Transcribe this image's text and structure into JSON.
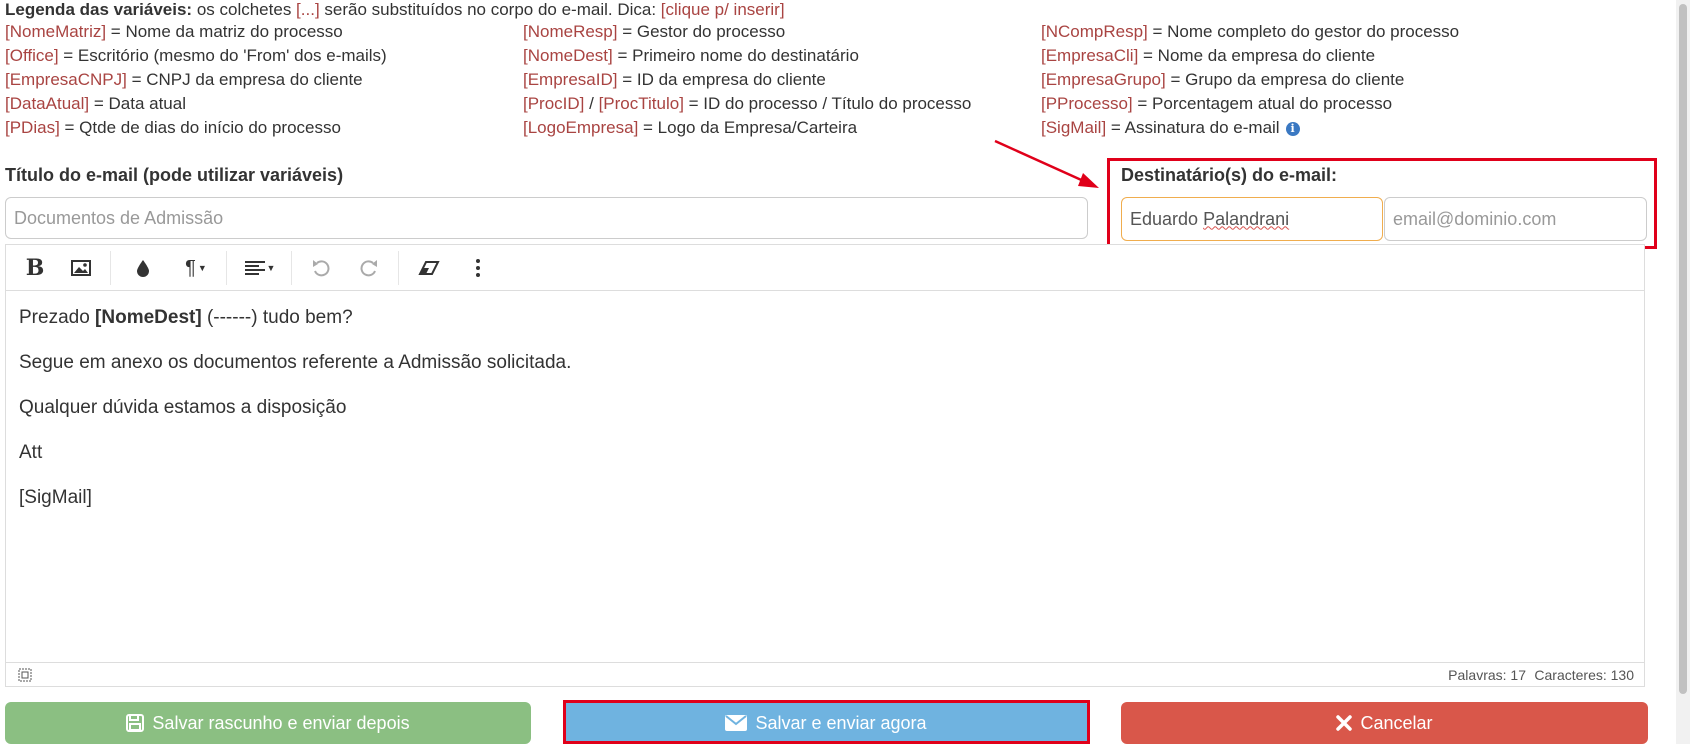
{
  "legend": {
    "title": "Legenda das variáveis:",
    "desc_before": " os colchetes ",
    "bracket": "[...]",
    "desc_after": " serão substituídos no corpo do e-mail. Dica: ",
    "tip": "[clique p/ inserir]",
    "col1": [
      {
        "var": "[NomeMatriz]",
        "desc": " = Nome da matriz do processo"
      },
      {
        "var": "[Office]",
        "desc": " = Escritório (mesmo do 'From' dos e-mails)"
      },
      {
        "var": "[EmpresaCNPJ]",
        "desc": " = CNPJ da empresa do cliente"
      },
      {
        "var": "[DataAtual]",
        "desc": " = Data atual"
      },
      {
        "var": "[PDias]",
        "desc": " = Qtde de dias do início do processo"
      }
    ],
    "col2": [
      {
        "var": "[NomeResp]",
        "desc": " = Gestor do processo"
      },
      {
        "var": "[NomeDest]",
        "desc": " = Primeiro nome do destinatário"
      },
      {
        "var": "[EmpresaID]",
        "desc": " = ID da empresa do cliente"
      },
      {
        "var": "[ProcID]",
        "sep": " / ",
        "var2": "[ProcTitulo]",
        "desc": " = ID do processo / Título do processo"
      },
      {
        "var": "[LogoEmpresa]",
        "desc": " = Logo da Empresa/Carteira"
      }
    ],
    "col3": [
      {
        "var": "[NCompResp]",
        "desc": " = Nome completo do gestor do processo"
      },
      {
        "var": "[EmpresaCli]",
        "desc": " = Nome da empresa do cliente"
      },
      {
        "var": "[EmpresaGrupo]",
        "desc": " = Grupo da empresa do cliente"
      },
      {
        "var": "[PProcesso]",
        "desc": " = Porcentagem atual do processo"
      },
      {
        "var": "[SigMail]",
        "desc": " = Assinatura do e-mail",
        "icon": "info-icon"
      }
    ]
  },
  "subject": {
    "label": "Título do e-mail (pode utilizar variáveis)",
    "placeholder": "Documentos de Admissão"
  },
  "recipients": {
    "label": "Destinatário(s) do e-mail:",
    "name_value": "Eduardo Palandrani",
    "email_placeholder": "email@dominio.com"
  },
  "toolbar": {
    "icons": [
      "bold-icon",
      "image-icon",
      "color-drop-icon",
      "paragraph-icon",
      "align-icon",
      "undo-icon",
      "redo-icon",
      "eraser-icon",
      "more-vertical-icon"
    ]
  },
  "body": {
    "line1_before": "Prezado ",
    "line1_bold": "[NomeDest]",
    "line1_after": " (------) tudo bem?",
    "line2": "Segue em anexo os documentos referente a Admissão solicitada.",
    "line3": "Qualquer dúvida estamos a disposição",
    "line4": "Att",
    "line5": "[SigMail]"
  },
  "status": {
    "words": "Palavras: 17",
    "chars": "Caracteres: 130"
  },
  "buttons": {
    "draft": "Salvar rascunho e enviar depois",
    "send": "Salvar e enviar agora",
    "cancel": "Cancelar"
  },
  "colors": {
    "variable": "#a94442",
    "success": "#8bbf82",
    "primary": "#6fb3e0",
    "danger": "#d9574a",
    "highlight": "#e0001a"
  }
}
